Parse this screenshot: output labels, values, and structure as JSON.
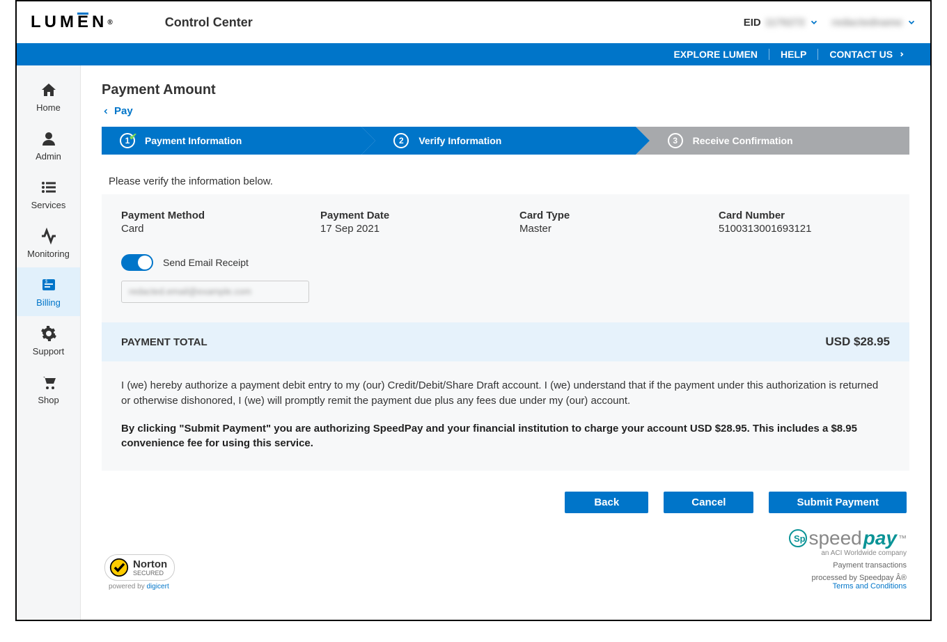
{
  "header": {
    "logo_text": "LUMEN",
    "app_name": "Control Center",
    "eid_label": "EID",
    "eid_value": "1176272",
    "user_name": "redactedname"
  },
  "navbar": {
    "explore": "EXPLORE LUMEN",
    "help": "HELP",
    "contact": "CONTACT US"
  },
  "sidebar": {
    "home": "Home",
    "admin": "Admin",
    "services": "Services",
    "monitoring": "Monitoring",
    "billing": "Billing",
    "support": "Support",
    "shop": "Shop"
  },
  "page": {
    "title": "Payment Amount",
    "back_link": "Pay"
  },
  "stepper": {
    "step1": {
      "num": "1",
      "label": "Payment Information"
    },
    "step2": {
      "num": "2",
      "label": "Verify Information"
    },
    "step3": {
      "num": "3",
      "label": "Receive Confirmation"
    }
  },
  "instruction": "Please verify the information below.",
  "details": {
    "method_label": "Payment Method",
    "method_value": "Card",
    "date_label": "Payment Date",
    "date_value": "17 Sep 2021",
    "type_label": "Card Type",
    "type_value": "Master",
    "number_label": "Card Number",
    "number_value": "5100313001693121"
  },
  "email": {
    "toggle_label": "Send Email Receipt",
    "value": "redacted.email@example.com"
  },
  "total": {
    "label": "PAYMENT TOTAL",
    "value": "USD $28.95"
  },
  "authorization": {
    "text": "I (we) hereby authorize a payment debit entry to my (our) Credit/Debit/Share Draft account. I (we) understand that if the payment under this authorization is returned or otherwise dishonored, I (we) will promptly remit the payment due plus any fees due under my (our) account.",
    "bold": "By clicking \"Submit Payment\" you are authorizing SpeedPay and your financial institution to charge your account USD $28.95. This includes a $8.95 convenience fee for using this service."
  },
  "buttons": {
    "back": "Back",
    "cancel": "Cancel",
    "submit": "Submit Payment"
  },
  "footer": {
    "norton": {
      "main": "Norton",
      "sub": "SECURED",
      "powered": "powered by ",
      "digicert": "digicert"
    },
    "speedpay": {
      "brand_light": "speed",
      "brand_bold": "pay",
      "subtitle": "an ACI Worldwide company",
      "line1": "Payment transactions",
      "line2": "processed by Speedpay Â®",
      "terms": "Terms and Conditions"
    }
  }
}
